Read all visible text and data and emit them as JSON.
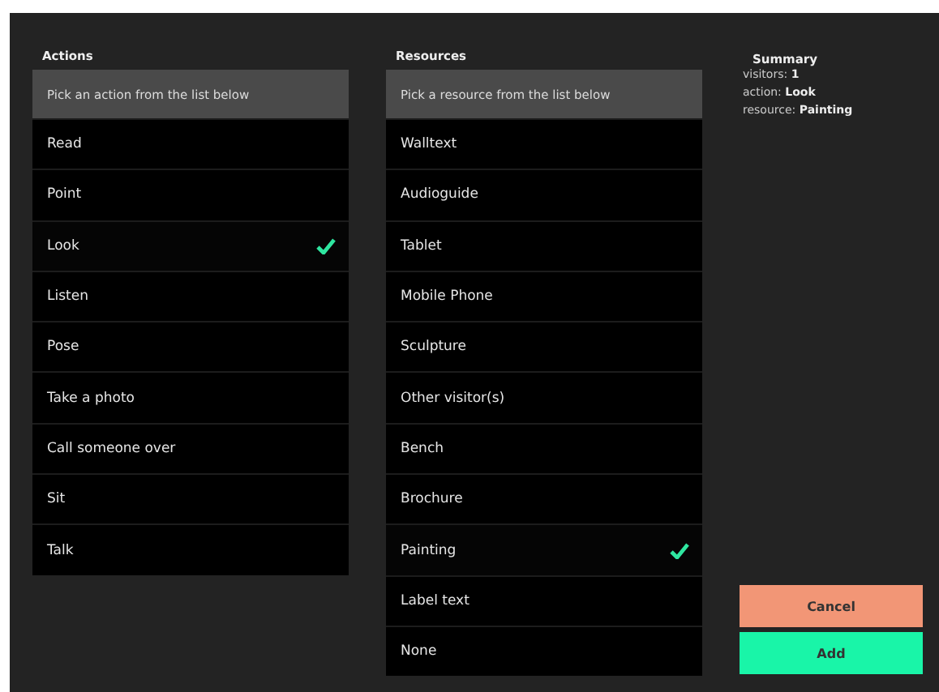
{
  "actions": {
    "title": "Actions",
    "prompt": "Pick an action from the list below",
    "items": [
      {
        "label": "Read",
        "selected": false
      },
      {
        "label": "Point",
        "selected": false
      },
      {
        "label": "Look",
        "selected": true
      },
      {
        "label": "Listen",
        "selected": false
      },
      {
        "label": "Pose",
        "selected": false
      },
      {
        "label": "Take a photo",
        "selected": false
      },
      {
        "label": "Call someone over",
        "selected": false
      },
      {
        "label": "Sit",
        "selected": false
      },
      {
        "label": "Talk",
        "selected": false
      }
    ]
  },
  "resources": {
    "title": "Resources",
    "prompt": "Pick a resource from the list below",
    "items": [
      {
        "label": "Walltext",
        "selected": false
      },
      {
        "label": "Audioguide",
        "selected": false
      },
      {
        "label": "Tablet",
        "selected": false
      },
      {
        "label": "Mobile Phone",
        "selected": false
      },
      {
        "label": "Sculpture",
        "selected": false
      },
      {
        "label": "Other visitor(s)",
        "selected": false
      },
      {
        "label": "Bench",
        "selected": false
      },
      {
        "label": "Brochure",
        "selected": false
      },
      {
        "label": "Painting",
        "selected": true
      },
      {
        "label": "Label text",
        "selected": false
      },
      {
        "label": "None",
        "selected": false
      }
    ]
  },
  "summary": {
    "title": "Summary",
    "lines": [
      "visitors: **1**",
      "action: **Look**",
      "resource: **Painting**"
    ]
  },
  "buttons": [
    {
      "label": "Cancel",
      "kind": "cancel"
    },
    {
      "label": "Add",
      "kind": "add"
    }
  ]
}
